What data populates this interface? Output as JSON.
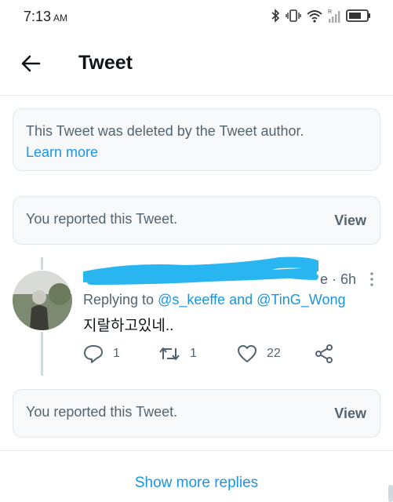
{
  "status_bar": {
    "time": "7:13",
    "ampm": "AM"
  },
  "header": {
    "title": "Tweet"
  },
  "deleted_notice": {
    "message": "This Tweet was deleted by the Tweet author.",
    "link": "Learn more"
  },
  "reported_notices": [
    {
      "message": "You reported this Tweet.",
      "action": "View"
    },
    {
      "message": "You reported this Tweet.",
      "action": "View"
    }
  ],
  "tweet": {
    "timestamp": "e · 6h",
    "replying_prefix": "Replying to",
    "mentions": [
      "@s_keeffe",
      "@TinG_Wong"
    ],
    "conjunction": "and",
    "text": "지랄하고있네..",
    "stats": {
      "replies": "1",
      "retweets": "1",
      "likes": "22"
    }
  },
  "footer": {
    "show_more": "Show more replies"
  },
  "colors": {
    "accent": "#1b95e0",
    "redaction": "#29b6f0",
    "notice_bg": "#f7f9fa"
  }
}
